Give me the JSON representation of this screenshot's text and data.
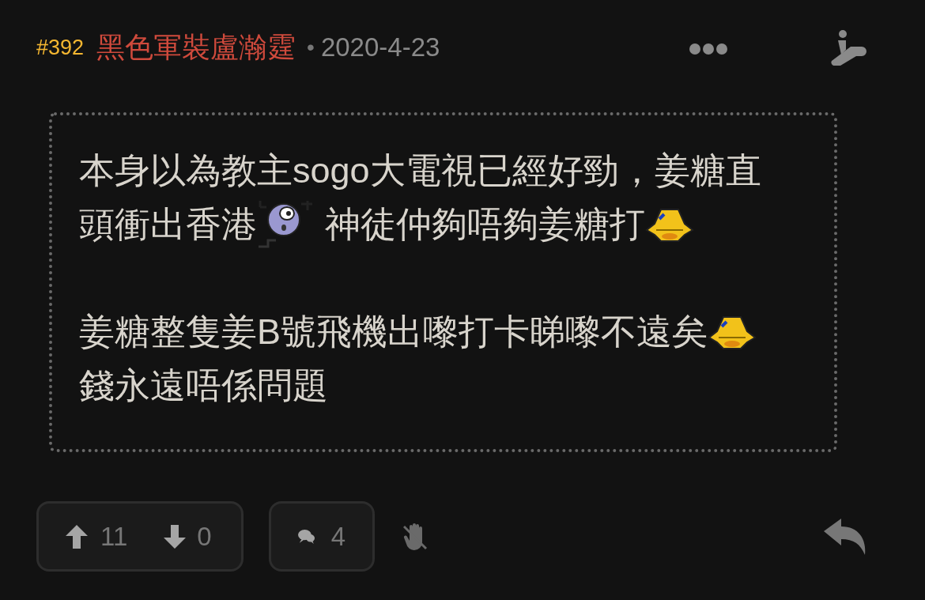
{
  "post": {
    "number": "#392",
    "author": "黑色軍裝盧瀚霆",
    "separator": "•",
    "date": "2020-4-23"
  },
  "content": {
    "paragraphs": [
      {
        "lines": [
          [
            {
              "kind": "text",
              "text": "本身以為教主sogo大電視已經好勁，姜糖直"
            }
          ],
          [
            {
              "kind": "text",
              "text": "頭衝出香港"
            },
            {
              "kind": "ball-sticker"
            },
            {
              "kind": "text",
              "text": "神徒仲夠唔夠姜糖打"
            },
            {
              "kind": "bell-sticker"
            }
          ]
        ]
      },
      {
        "lines": [
          [
            {
              "kind": "text",
              "text": "姜糖整隻姜B號飛機出嚟打卡睇嚟不遠矣"
            },
            {
              "kind": "bell-sticker"
            }
          ],
          [
            {
              "kind": "text",
              "text": "錢永遠唔係問題"
            }
          ]
        ]
      }
    ]
  },
  "footer": {
    "upvotes": "11",
    "downvotes": "0",
    "comments": "4"
  }
}
